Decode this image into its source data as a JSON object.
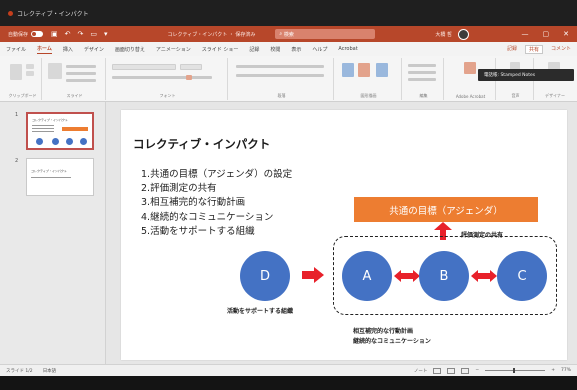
{
  "window": {
    "title": "コレクティブ・インパクト",
    "autosave_label": "自動保存",
    "search_placeholder": "検索",
    "user_name": "大橋 哲",
    "doc_title": "コレクティブ・インパクト ・ 保存済み"
  },
  "ribbon": {
    "tabs": [
      "ファイル",
      "ホーム",
      "挿入",
      "デザイン",
      "画面切り替え",
      "アニメーション",
      "スライド ショー",
      "記録",
      "校閲",
      "表示",
      "ヘルプ",
      "Acrobat"
    ],
    "active_tab": "ホーム",
    "record_label": "記録",
    "share_label": "共有",
    "comments_label": "コメント",
    "groups": [
      "クリップボード",
      "スライド",
      "フォント",
      "段落",
      "図形描画",
      "編集",
      "Adobe Acrobat",
      "音声",
      "デザイナー"
    ],
    "tooltip": "電話帳: Stamped Notes"
  },
  "thumbnails": [
    {
      "number": "1",
      "title": "コレクティブ・インパクト"
    },
    {
      "number": "2",
      "title": "コレクティブ・インパクト"
    }
  ],
  "slide": {
    "title": "コレクティブ・インパクト",
    "agenda": [
      "1.共通の目標（アジェンダ）の設定",
      "2.評価測定の共有",
      "3.相互補完的な行動計画",
      "4.継続的なコミュニケーション",
      "5.活動をサポートする組織"
    ],
    "goal_box": "共通の目標（アジェンダ）",
    "up_label": "評価測定の共有",
    "nodes": [
      "D",
      "A",
      "B",
      "C"
    ],
    "d_label": "活動をサポートする組織",
    "bottom_labels": [
      "相互補完的な行動計画",
      "継続的なコミュニケーション"
    ],
    "colors": {
      "accent": "#ed7d31",
      "node": "#4472c4",
      "arrow": "#e8212a",
      "brand": "#b7472a"
    }
  },
  "statusbar": {
    "slide_info": "スライド 1/2",
    "language": "日本語",
    "notes_label": "ノート",
    "zoom": "77%"
  }
}
